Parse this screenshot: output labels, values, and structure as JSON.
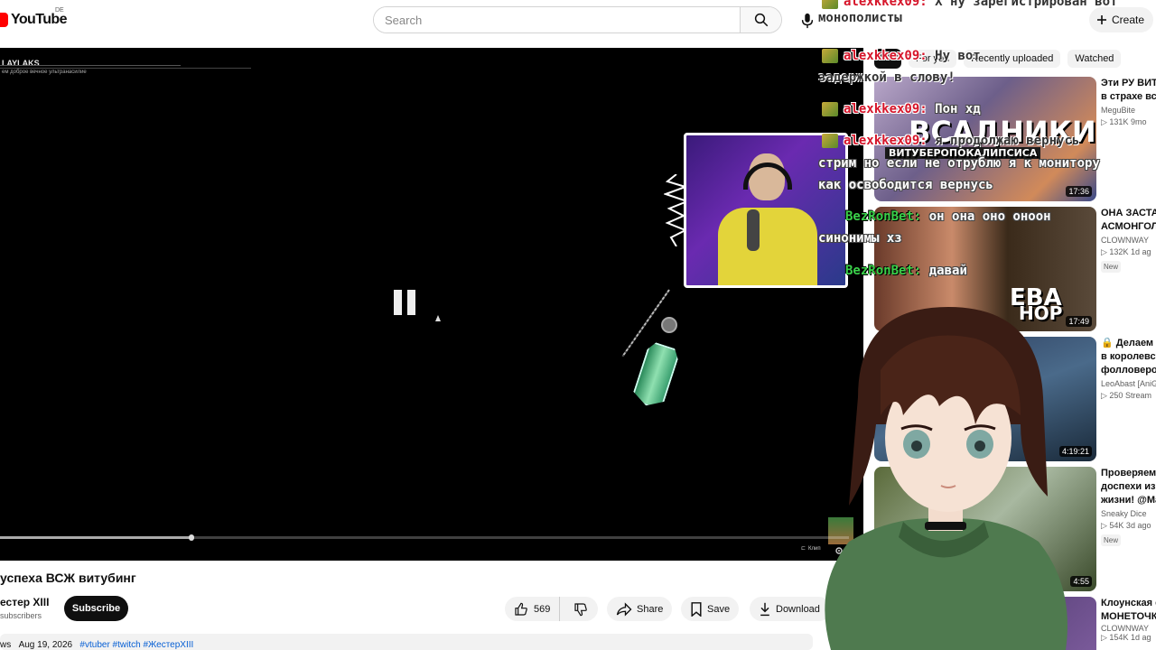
{
  "header": {
    "logo_text": "YouTube",
    "logo_region": "DE",
    "search_placeholder": "Search",
    "create_label": "Create"
  },
  "player": {
    "title": "LAYLAKS",
    "subtitle": "ем доброе вечное ультранасилие",
    "progress": 0.225,
    "clip_label": "Клип"
  },
  "chat": [
    {
      "user": "alexkkex09:",
      "msg": "Х ну зарегистрирован вот",
      "user_color": "#d6152a",
      "badge": true,
      "msg_style": "dark",
      "line2": "монополисты"
    },
    {
      "user": "alexkkex09:",
      "msg": "Ну вот",
      "user_color": "#d6152a",
      "badge": true,
      "msg_style": "dark",
      "line2": "задержкой в слову!"
    },
    {
      "user": "alexkkex09:",
      "msg": "Пон хд",
      "user_color": "#d6152a",
      "badge": true,
      "msg_style": "white",
      "line2": ""
    },
    {
      "user": "alexkkex09:",
      "msg": "я продолжаю вернусь",
      "user_color": "#d6152a",
      "badge": true,
      "msg_style": "dark",
      "line2": "стрим но если не отрублю я к монитору",
      "line3": "как освободится вернусь"
    },
    {
      "user": "BezRonBet:",
      "msg": "он она оно оноон",
      "user_color": "#3ad14a",
      "badge": false,
      "msg_style": "white",
      "line2": "синонимы хз"
    },
    {
      "user": "BezRonBet:",
      "msg": "давай",
      "user_color": "#3ad14a",
      "badge": false,
      "msg_style": "white",
      "line2": ""
    }
  ],
  "chips": [
    "For you",
    "Recently uploaded",
    "Watched"
  ],
  "recommendations": [
    {
      "title": "Эти РУ ВИТУ",
      "title2": "в страхе вск",
      "channel": "MeguBite",
      "meta": "▷ 131K  9mo",
      "duration": "17:36",
      "thumb_text": "ВСАДНИКИ",
      "thumb_sub": "ВИТУБЕРОПОКАЛИПСИСА",
      "new": ""
    },
    {
      "title": "ОНА ЗАСТАВ",
      "title2": "АСМОНГОЛ",
      "channel": "CLOWNWAY",
      "meta": "▷ 132K  1d ag",
      "duration": "17:49",
      "thumb_text": "ЕВА",
      "thumb_sub": "НОР",
      "new": "New"
    },
    {
      "title": "🔒 Делаем А",
      "title2": "в королевст",
      "title3": "фолловеров",
      "channel": "LeoAbast [AniG",
      "meta": "▷ 250  Stream",
      "duration": "4:19:21",
      "thumb_text": "",
      "thumb_sub": "",
      "new": ""
    },
    {
      "title": "Проверяем",
      "title2": "доспехи из",
      "title3": "жизни! @Ma",
      "channel": "Sneaky Dice",
      "meta": "▷ 54K  3d ago",
      "duration": "4:55",
      "thumb_text": "",
      "thumb_sub": "",
      "new": "New"
    },
    {
      "title": "Клоунская о",
      "title2": "МОНЕТОЧК",
      "channel": "CLOWNWAY",
      "meta": "▷ 154K  1d ag",
      "duration": "",
      "thumb_text": "",
      "thumb_sub": "",
      "new": ""
    }
  ],
  "video": {
    "title": "успеха ВСЖ витубинг",
    "channel": "естер XIII",
    "subscribers": "subscribers",
    "subscribe_label": "Subscribe",
    "likes": "569",
    "share_label": "Share",
    "save_label": "Save",
    "download_label": "Download",
    "views_prefix": "ws",
    "date": "Aug 19, 2026",
    "tags": "#vtuber #twitch #ЖестерXIII"
  },
  "colors": {
    "accent_red": "#ff0000",
    "chat_red": "#d6152a",
    "chat_green": "#3ad14a",
    "link_blue": "#065fd4"
  }
}
